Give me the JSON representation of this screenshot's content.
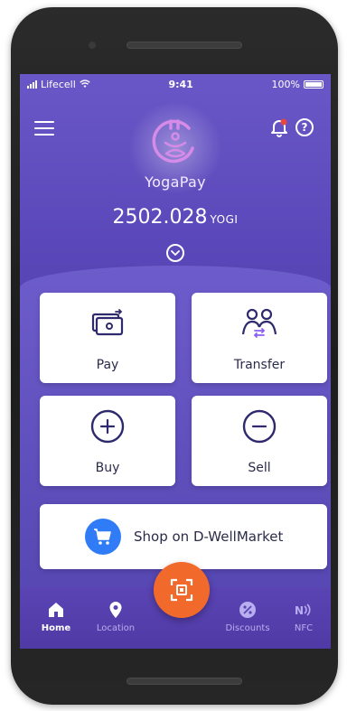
{
  "status_bar": {
    "carrier": "Lifecell",
    "time": "9:41",
    "battery": "100%"
  },
  "header": {
    "brand_name": "YogaPay"
  },
  "balance": {
    "amount": "2502.028",
    "unit": "YOGI"
  },
  "actions": [
    {
      "label": "Pay",
      "icon": "cash-icon"
    },
    {
      "label": "Transfer",
      "icon": "transfer-users-icon"
    },
    {
      "label": "Buy",
      "icon": "plus-circle-icon"
    },
    {
      "label": "Sell",
      "icon": "minus-circle-icon"
    }
  ],
  "shop": {
    "label": "Shop on D-WellMarket",
    "icon": "cart-icon"
  },
  "tabs": [
    {
      "label": "Home",
      "icon": "home-icon",
      "active": true
    },
    {
      "label": "Location",
      "icon": "location-pin-icon",
      "active": false
    },
    {
      "label": "Discounts",
      "icon": "discount-icon",
      "active": false
    },
    {
      "label": "NFC",
      "icon": "nfc-icon",
      "active": false
    }
  ],
  "colors": {
    "accent": "#6a57c7",
    "scan_button": "#f26a2b",
    "shop_icon": "#2f7cf6",
    "notification_dot": "#e8473f"
  }
}
